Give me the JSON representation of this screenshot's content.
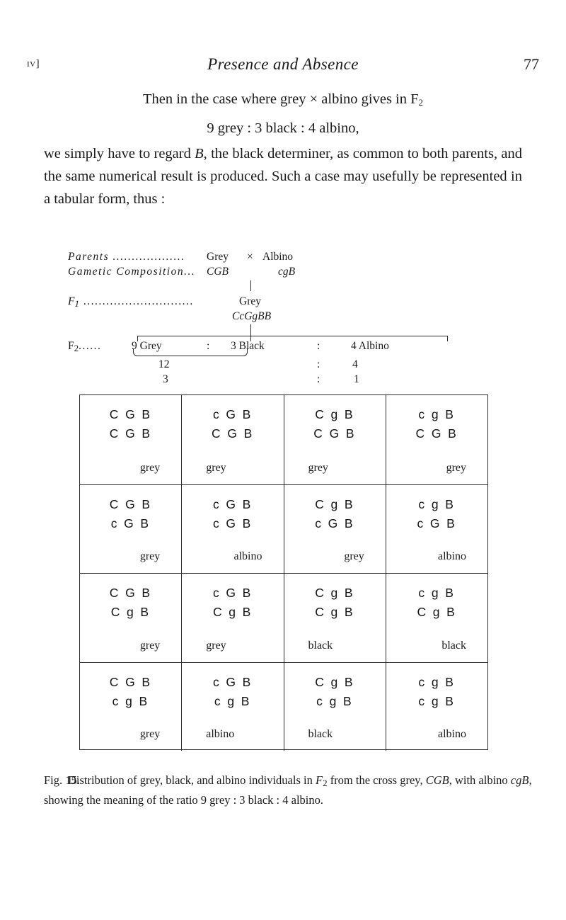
{
  "runhead": {
    "folio_left": "iv]",
    "title": "Presence and Absence",
    "folio_right": "77"
  },
  "body": {
    "p1": "Then in the case where grey × albino gives in F",
    "p1_sub": "2",
    "p2": "9 grey : 3 black : 4 albino,",
    "p3_a": "we simply have to regard ",
    "p3_b": "B",
    "p3_c": ", the black determiner, as common to both parents, and the same numerical result is produced. Such a case may usefully be represented in a tabular form, thus :"
  },
  "pedigree": {
    "parents_label": "Parents ...................",
    "parents_v1": "Grey",
    "parents_x": "×",
    "parents_v2": "Albino",
    "gametic_label": "Gametic Composition...",
    "gametic_v1": "CGB",
    "gametic_v2": "cgB",
    "f1_label": "F",
    "f1_sub": "1",
    "f1_dots": ".............................",
    "f1_v1": "Grey",
    "f1_v2": "CcGgBB",
    "f2_label": "F",
    "f2_sub": "2",
    "f2_dots": "......",
    "f2_c1": "9 Grey",
    "f2_colon1": ":",
    "f2_c3": "3 Black",
    "f2_colon2": ":",
    "f2_c5": "4 Albino",
    "f2_sub1": "12",
    "f2_sub1b": "3",
    "f2_sub2": "4",
    "f2_sub2b": "1"
  },
  "grid": {
    "rows": [
      [
        {
          "g1": "C G B",
          "g2": "C G B",
          "note": "grey",
          "note_align": "right"
        },
        {
          "g1": "c G B",
          "g2": "C G B",
          "note": "grey",
          "note_align": "left"
        },
        {
          "g1": "C g B",
          "g2": "C G B",
          "note": "grey",
          "note_align": "left"
        },
        {
          "g1": "c g B",
          "g2": "C G B",
          "note": "grey",
          "note_align": "right"
        }
      ],
      [
        {
          "g1": "C G B",
          "g2": "c G B",
          "note": "grey",
          "note_align": "right"
        },
        {
          "g1": "c G B",
          "g2": "c G B",
          "note": "albino",
          "note_align": "right"
        },
        {
          "g1": "C g B",
          "g2": "c G B",
          "note": "grey",
          "note_align": "right"
        },
        {
          "g1": "c g B",
          "g2": "c G B",
          "note": "albino",
          "note_align": "right"
        }
      ],
      [
        {
          "g1": "C G B",
          "g2": "C g B",
          "note": "grey",
          "note_align": "right"
        },
        {
          "g1": "c G B",
          "g2": "C g B",
          "note": "grey",
          "note_align": "left"
        },
        {
          "g1": "C g B",
          "g2": "C g B",
          "note": "black",
          "note_align": "left"
        },
        {
          "g1": "c g B",
          "g2": "C g B",
          "note": "black",
          "note_align": "right"
        }
      ],
      [
        {
          "g1": "C G B",
          "g2": "c g B",
          "note": "grey",
          "note_align": "right"
        },
        {
          "g1": "c G B",
          "g2": "c g B",
          "note": "albino",
          "note_align": "left"
        },
        {
          "g1": "C g B",
          "g2": "c g B",
          "note": "black",
          "note_align": "left"
        },
        {
          "g1": "c g B",
          "g2": "c g B",
          "note": "albino",
          "note_align": "right"
        }
      ]
    ]
  },
  "caption": {
    "label": "Fig. 15.",
    "line1_a": "Distribution of grey, black, and albino individuals in ",
    "line1_f": "F",
    "line1_sub": "2",
    "line1_b": " from the cross grey, ",
    "line1_i1": "CGB",
    "line1_c": ", with albino ",
    "line1_i2": "cgB",
    "line1_d": ", showing the meaning of the ratio 9 grey : 3 black : 4 albino."
  }
}
